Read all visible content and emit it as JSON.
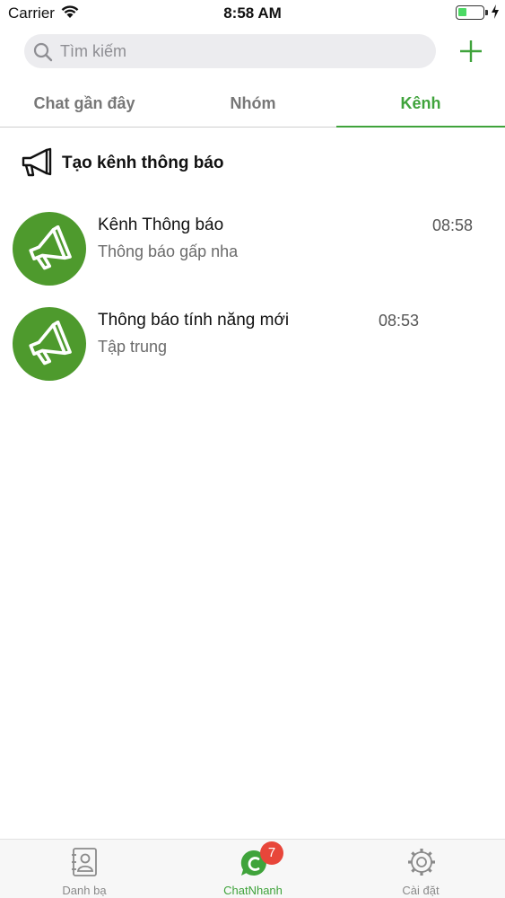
{
  "status_bar": {
    "carrier": "Carrier",
    "time": "8:58 AM",
    "battery_level": 0.35,
    "battery_color": "#4cd964"
  },
  "search": {
    "placeholder": "Tìm kiếm",
    "icon": "search-icon",
    "add_icon": "plus-icon"
  },
  "tabs": [
    {
      "label": "Chat gần đây",
      "active": false
    },
    {
      "label": "Nhóm",
      "active": false
    },
    {
      "label": "Kênh",
      "active": true
    }
  ],
  "create_channel": {
    "label": "Tạo kênh thông báo",
    "icon": "megaphone-icon"
  },
  "channels": [
    {
      "name": "Kênh Thông báo",
      "preview": "Thông báo gấp nha",
      "time": "08:58"
    },
    {
      "name": "Thông báo tính năng mới",
      "preview": "Tập trung",
      "time": "08:53"
    }
  ],
  "bottom_nav": [
    {
      "label": "Danh bạ",
      "icon": "contacts-icon",
      "active": false
    },
    {
      "label": "ChatNhanh",
      "icon": "chat-icon",
      "active": true,
      "badge": "7"
    },
    {
      "label": "Cài đặt",
      "icon": "settings-icon",
      "active": false
    }
  ],
  "colors": {
    "accent": "#3fa33b",
    "avatar_bg": "#4e9a2d",
    "badge": "#e8463a"
  }
}
